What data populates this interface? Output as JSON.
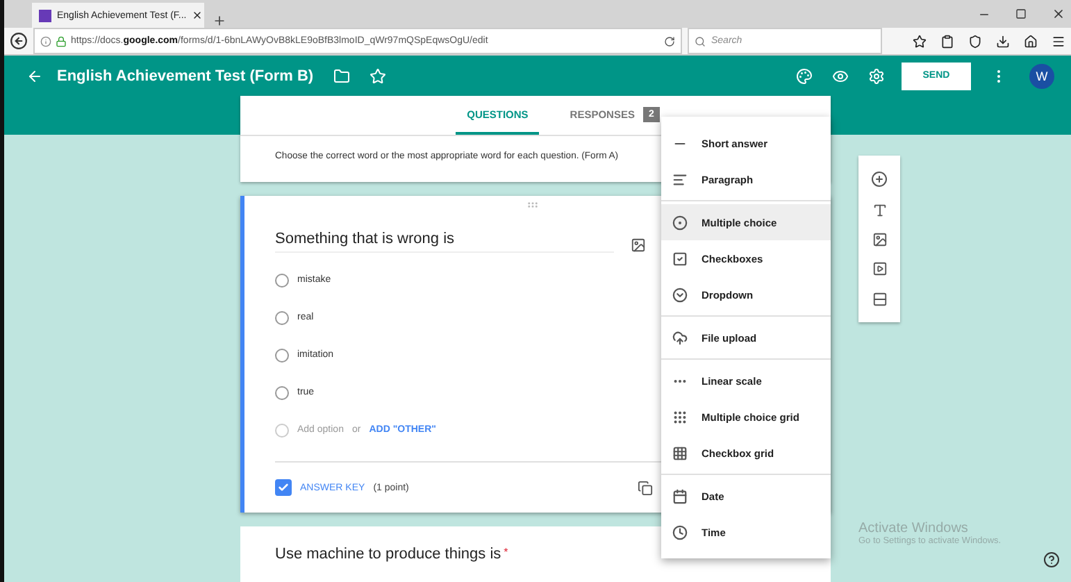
{
  "browser": {
    "tab_title": "English Achievement Test (F...",
    "url_prefix": "https://docs.",
    "url_domain": "google.com",
    "url_path": "/forms/d/1-6bnLAWyOvB8kLE9oBfB3lmoID_qWr97mQSpEqwsOgU/edit",
    "search_placeholder": "Search"
  },
  "header": {
    "title": "English Achievement Test (Form B)",
    "send": "SEND",
    "avatar": "W"
  },
  "tabs": [
    {
      "label": "QUESTIONS",
      "selected": true
    },
    {
      "label": "RESPONSES",
      "selected": false,
      "badge": "2"
    }
  ],
  "description": "Choose the correct word or the most appropriate word for each question. (Form A)",
  "question": {
    "title": "Something that is wrong is",
    "options": [
      {
        "label": "mistake",
        "selected": false
      },
      {
        "label": "real",
        "selected": false
      },
      {
        "label": "imitation",
        "selected": false
      },
      {
        "label": "true",
        "selected": false
      }
    ],
    "add_option": "Add option",
    "or": "or",
    "add_other": "ADD \"OTHER\"",
    "answer_key": "ANSWER KEY",
    "answer_key_checked": true,
    "points": "(1 point)"
  },
  "next_question": {
    "title": "Use machine to produce things is",
    "required_mark": "*"
  },
  "menu": [
    [
      {
        "label": "Short answer",
        "kind": "short",
        "selected": false
      },
      {
        "label": "Paragraph",
        "kind": "paragraph",
        "selected": false
      }
    ],
    [
      {
        "label": "Multiple choice",
        "kind": "radio",
        "selected": true
      },
      {
        "label": "Checkboxes",
        "kind": "checkbox",
        "selected": false
      },
      {
        "label": "Dropdown",
        "kind": "dropdown",
        "selected": false
      }
    ],
    [
      {
        "label": "File upload",
        "kind": "upload",
        "selected": false
      }
    ],
    [
      {
        "label": "Linear scale",
        "kind": "scale",
        "selected": false
      },
      {
        "label": "Multiple choice grid",
        "kind": "dotgrid",
        "selected": false
      },
      {
        "label": "Checkbox grid",
        "kind": "boxgrid",
        "selected": false
      }
    ],
    [
      {
        "label": "Date",
        "kind": "date",
        "selected": false
      },
      {
        "label": "Time",
        "kind": "time",
        "selected": false
      }
    ]
  ],
  "os_notice": {
    "title": "Activate Windows",
    "subtitle": "Go to Settings to activate Windows."
  }
}
